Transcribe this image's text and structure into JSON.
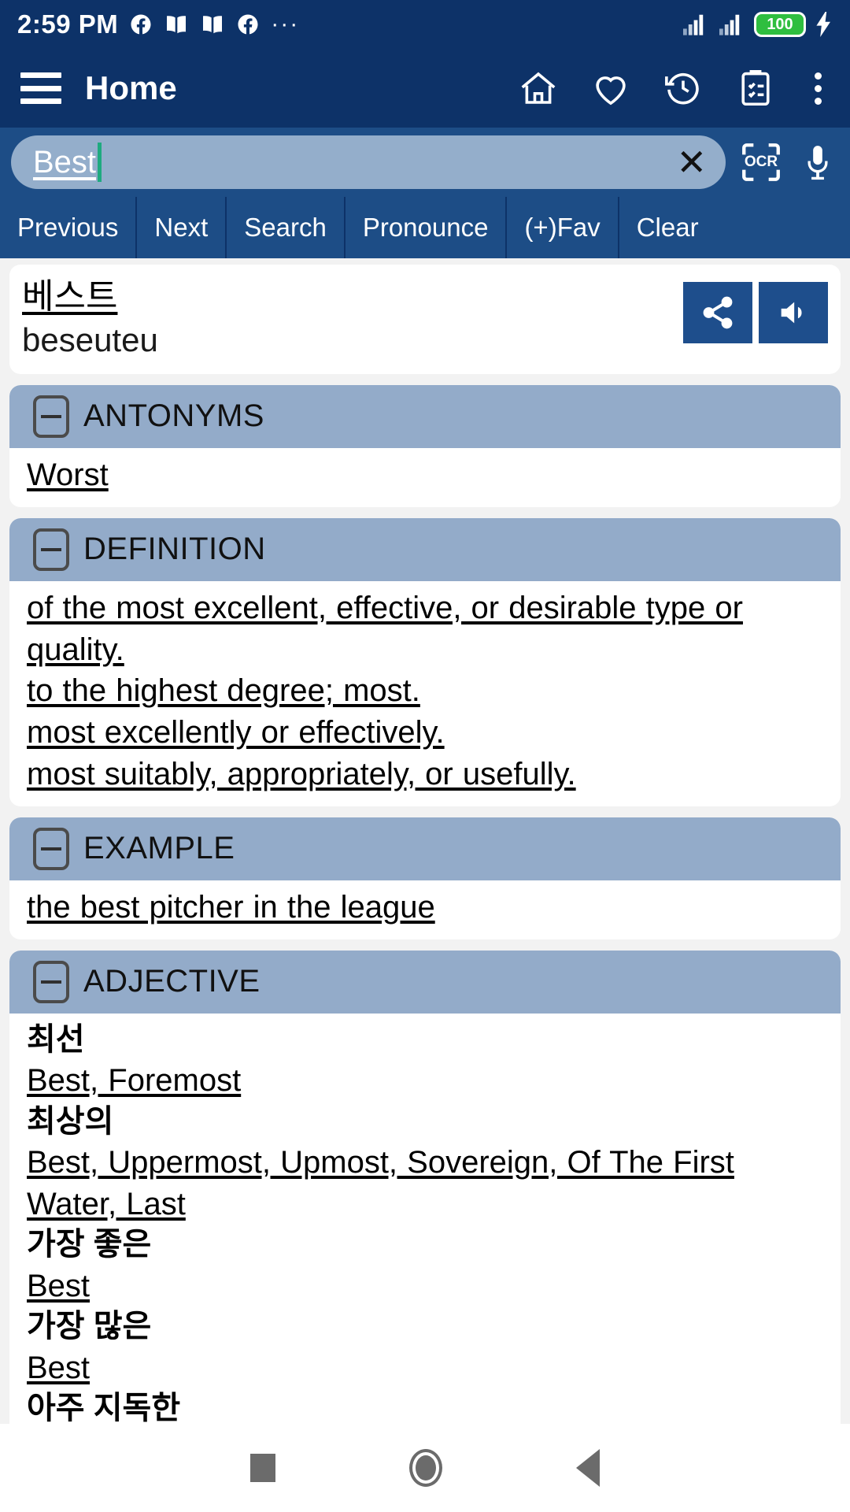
{
  "status_bar": {
    "time": "2:59 PM",
    "notification_icons": [
      "facebook-icon",
      "book-icon",
      "book-icon",
      "facebook-icon"
    ],
    "overflow_dots": "···",
    "signal_icons": [
      "signal-bars-icon",
      "signal-bars-icon"
    ],
    "battery_level": "100",
    "charging": true
  },
  "app_bar": {
    "menu_icon": "hamburger-menu-icon",
    "title": "Home",
    "actions": [
      "home-icon",
      "heart-icon",
      "history-icon",
      "clipboard-icon",
      "overflow-menu-icon"
    ]
  },
  "search": {
    "value": "Best",
    "clear_label": "✕",
    "ocr_label": "OCR",
    "mic_icon": "microphone-icon"
  },
  "toolbar": {
    "buttons": [
      {
        "label": "Previous"
      },
      {
        "label": "Next"
      },
      {
        "label": "Search"
      },
      {
        "label": "Pronounce"
      },
      {
        "label": "(+)Fav"
      },
      {
        "label": "Clear"
      }
    ]
  },
  "headword": {
    "korean": "베스트",
    "romanization": "beseuteu",
    "share_icon": "share-icon",
    "speak_icon": "volume-up-icon"
  },
  "sections": [
    {
      "title": "ANTONYMS",
      "collapse_icon": "minus-box-icon",
      "lines": [
        "Worst"
      ]
    },
    {
      "title": "DEFINITION",
      "collapse_icon": "minus-box-icon",
      "lines": [
        "of the most excellent, effective, or desirable type or quality.",
        "to the highest degree; most.",
        "most excellently or effectively.",
        "most suitably, appropriately, or usefully."
      ]
    },
    {
      "title": "EXAMPLE",
      "collapse_icon": "minus-box-icon",
      "lines": [
        "the best pitcher in the league"
      ]
    },
    {
      "title": "ADJECTIVE",
      "collapse_icon": "minus-box-icon",
      "entries": [
        {
          "korean": "최선",
          "english": "Best, Foremost"
        },
        {
          "korean": "최상의",
          "english": "Best, Uppermost, Upmost, Sovereign, Of The First Water, Last"
        },
        {
          "korean": "가장 좋은",
          "english": "Best"
        },
        {
          "korean": "가장 많은",
          "english": "Best"
        },
        {
          "korean": "아주 지독한",
          "english": ""
        }
      ]
    }
  ],
  "nav_bar": {
    "recents_icon": "square-recents-icon",
    "home_icon": "circle-home-icon",
    "back_icon": "triangle-back-icon"
  },
  "colors": {
    "app_bar": "#0d3268",
    "toolbar": "#1d4d86",
    "section_header": "#93abc9",
    "accent_button": "#1e4e8c",
    "caret": "#1faa7f",
    "battery_green": "#2fbe3f"
  }
}
